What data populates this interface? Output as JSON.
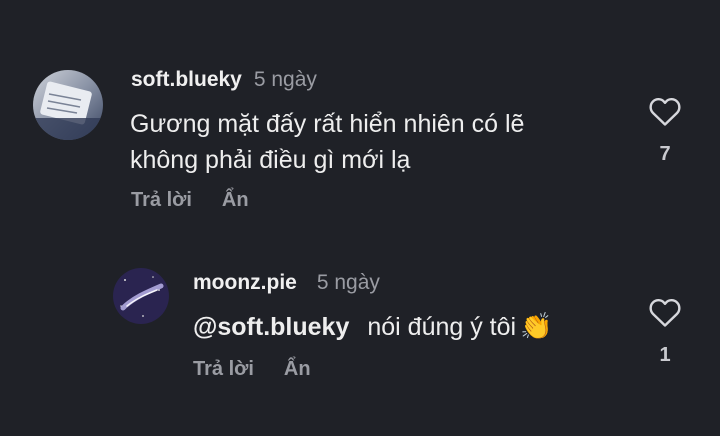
{
  "comments": [
    {
      "username": "soft.blueky",
      "time": "5 ngày",
      "text_line1": "Gương mặt đấy rất hiển nhiên có lẽ",
      "text_line2": "không phải điều gì mới lạ",
      "reply_label": "Trả lời",
      "hide_label": "Ẩn",
      "like_count": "7",
      "icon": "heart-icon"
    }
  ],
  "replies": [
    {
      "username": "moonz.pie",
      "time": "5 ngày",
      "mention": "@soft.blueky",
      "text": "nói đúng ý tôi",
      "emoji": "👏",
      "reply_label": "Trả lời",
      "hide_label": "Ẩn",
      "like_count": "1",
      "icon": "heart-icon"
    }
  ],
  "colors": {
    "background": "#1f2127",
    "text": "#eeeeee",
    "muted": "#9a9ca3"
  }
}
